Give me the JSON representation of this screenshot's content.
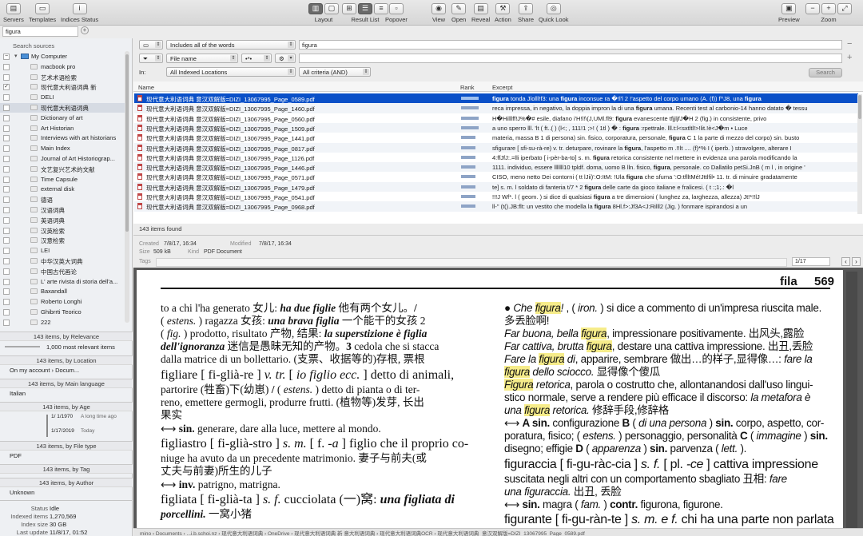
{
  "toolbar": {
    "servers": "Servers",
    "templates": "Templates",
    "indices_status": "Indices Status",
    "layout": "Layout",
    "result_list": "Result List",
    "popover": "Popover",
    "view": "View",
    "open": "Open",
    "reveal": "Reveal",
    "action": "Action",
    "share": "Share",
    "quick_look": "Quick Look",
    "preview": "Preview",
    "zoom": "Zoom"
  },
  "sidebar": {
    "search_value": "figura",
    "search_sources": "Search sources",
    "sources": [
      {
        "label": "My Computer",
        "checked": "minus"
      },
      {
        "label": "macbook pro"
      },
      {
        "label": "艺术术语检索"
      },
      {
        "label": "现代意大利语词典 新",
        "checked": "check"
      },
      {
        "label": "DELI"
      },
      {
        "label": "现代意大利语词典",
        "selected": true
      },
      {
        "label": "Dictionary of art"
      },
      {
        "label": "Art Historian"
      },
      {
        "label": "Interviews with art historians"
      },
      {
        "label": "Main Index"
      },
      {
        "label": "Journal of Art Historiograp..."
      },
      {
        "label": "文艺复兴艺术的文献"
      },
      {
        "label": "Time Capsule"
      },
      {
        "label": "external disk"
      },
      {
        "label": "德语"
      },
      {
        "label": "汉语词典"
      },
      {
        "label": "英语词典"
      },
      {
        "label": "汉英检索"
      },
      {
        "label": "汉意检索"
      },
      {
        "label": "LEI"
      },
      {
        "label": "中华汉英大词典"
      },
      {
        "label": "中国古代画论"
      },
      {
        "label": "L' arte rivista di storia dell'a..."
      },
      {
        "label": "Baxandall"
      },
      {
        "label": "Roberto Longhi"
      },
      {
        "label": "Ghibrrti Teorico"
      },
      {
        "label": "222"
      }
    ]
  },
  "facets": {
    "relevance_header": "143 items, by Relevance",
    "relevance_label": "1,000 most relevant items",
    "location_header": "143 items, by Location",
    "location_label": "On my account › Docum...",
    "location_count": "143",
    "language_header": "143 items, by Main language",
    "language_label": "Italian",
    "language_count": "143",
    "age_header": "143 items, by Age",
    "age_row1_date": "1/  1/1970",
    "age_row1_label": "A long time ago",
    "age_row2_date": "1/17/2019",
    "age_row2_label": "Today",
    "filetype_header": "143 items, by File type",
    "filetype_label": "PDF",
    "filetype_count": "143",
    "tag_header": "143 items, by Tag",
    "author_header": "143 items, by Author",
    "author_label": "Unknown",
    "author_count": "143"
  },
  "status": {
    "status_k": "Status",
    "status_v": "Idle",
    "indexed_k": "Indexed items",
    "indexed_v": "1,270,569",
    "size_k": "Index size",
    "size_v": "30 GB",
    "update_k": "Last update",
    "update_v": "11/8/17, 01:52"
  },
  "query": {
    "mode": "Includes all of the words",
    "term": "figura",
    "filter": "File name",
    "location": "All Indexed Locations",
    "criteria": "All criteria (AND)",
    "in_label": "In:",
    "search_button": "Search"
  },
  "results": {
    "col_name": "Name",
    "col_rank": "Rank",
    "col_excerpt": "Excerpt",
    "found": "143 items found",
    "rows": [
      {
        "name": "现代意大利语词典  意汉双解版=DIZI_13067995_Page_0589.pdf",
        "rank": 0.55,
        "ex_pre": "",
        "ex_hit": "figura",
        "ex_post": " tonda Jlolll!f3: una ",
        "ex_hit2": "figura",
        "ex_post2": " inconsue ra �!l'l 2 !'aspetto del corpo umano (A. (f)) f^J8, una ",
        "ex_hit3": "figura"
      },
      {
        "name": "现代意大利语词典  意汉双解版=DIZI_13067995_Page_1460.pdf",
        "rank": 0.55,
        "ex_pre": "reca impressa, in negativo, la doppia impron la di una ",
        "ex_hit": "figura",
        "ex_post": " umana. Recenti test al carbonio-14 hanno datato � tessu"
      },
      {
        "name": "现代意大利语词典  意汉双解版=DIZI_13067995_Page_0560.pdf",
        "rank": 0.55,
        "ex_pre": "H�Hilllff!J%�# esile, diafano i'H!l!\\(J,UMl.fl9: ",
        "ex_hit": "figura",
        "ex_post": " evanescente tfjjljfJ�H 2 (fig.) in consistente, privo"
      },
      {
        "name": "现代意大利语词典  意汉双解版=DIZI_13067995_Page_1509.pdf",
        "rank": 0.55,
        "ex_pre": "a uno sperro lll. 'lt ( ft..( ) (l<; , 111!1 ;>! ( 1tl ) � : ",
        "ex_hit": "figura",
        "ex_post": " :rpettrale. lll.t:l<sxtltl!>!lit.!è<J�m • Luce"
      },
      {
        "name": "现代意大利语词典  意汉双解版=DIZI_13067995_Page_1441.pdf",
        "rank": 0.44,
        "ex_pre": "materia, massa B 1 di persona) sin. fisico, corporatura, personale, ",
        "ex_hit": "figura",
        "ex_post": " C 1 la parte di mezzo del corpo) sin. busto"
      },
      {
        "name": "现代意大利语词典  意汉双解版=DIZI_13067995_Page_0817.pdf",
        "rank": 0.44,
        "ex_pre": "sfigurare [ sfi-su-rà-re) v. tr. deturpare, rovinare la ",
        "ex_hit": "figura",
        "ex_post": ", l'aspetto m .!!lt .... (f)*% I ( iperb. ) stravolgere, alterare I"
      },
      {
        "name": "现代意大利语词典  意汉双解版=DIZI_13067995_Page_1126.pdf",
        "rank": 0.44,
        "ex_pre": "4:ffJfJ:.=lli iperbato [ i-pèr-ba-to] s. m. ",
        "ex_hit": "figura",
        "ex_post": " retorica consistente nel mettere in evidenza una parola modificando la"
      },
      {
        "name": "现代意大利语词典  意汉双解版=DIZI_13067995_Page_1446.pdf",
        "rank": 0.44,
        "ex_pre": "1111. individuo, essere lllllll10 tpldf. doma, uomo B lln. fisico, ",
        "ex_hit": "figura",
        "ex_post": ", personale. co Dallatilo petSi.JnB ( m l , in origine '"
      },
      {
        "name": "现代意大利语词典  意汉双解版=DIZI_13067995_Page_0571.pdf",
        "rank": 0.44,
        "ex_pre": "CISO, meno netto Dei contorni ( tt lJii)':O:ItM: !Ula ",
        "ex_hit": "figura",
        "ex_post": " che sfuma ':O:tflltMé!Jttlfil• 11. tr. di minuire gradatamente"
      },
      {
        "name": "现代意大利语词典  意汉双解版=DIZI_13067995_Page_1479.pdf",
        "rank": 0.44,
        "ex_pre": "te] s. m. l soldato di fanteria t/7 * 2 ",
        "ex_hit": "figura",
        "ex_post": " delle carte da gioco italiane e fralicesi. ( t :;1;.: �l"
      },
      {
        "name": "现代意大利语词典  意汉双解版=DIZI_13067995_Page_0541.pdf",
        "rank": 0.44,
        "ex_pre": "!!!J Wf*. l ( geom. ) si dice di qualsiasi ",
        "ex_hit": "figura",
        "ex_post": " a tre dimensioni ( lunghez za, larghezza, allezza) Jt!*!!lJ"
      },
      {
        "name": "现代意大利语词典  意汉双解版=DIZI_13067995_Page_0968.pdf",
        "rank": 0.44,
        "ex_pre": "ll-\" (t().JB:flt: un vestito che modella la ",
        "ex_hit": "figura",
        "ex_post": " 8Hl.f>:Jf3A<J:Rilll2 (Jig. ) fonmare ispirandosi a un"
      }
    ]
  },
  "info": {
    "created_k": "Created",
    "created_v": "7/8/17, 16:34",
    "modified_k": "Modified",
    "modified_v": "7/8/17, 16:34",
    "size_k": "Size",
    "size_v": "509 kB",
    "kind_k": "Kind",
    "kind_v": "PDF Document",
    "tags_k": "Tags",
    "page_indicator": "1/17"
  },
  "document": {
    "running_head": "fila",
    "page_number": "569"
  },
  "path": {
    "text": "mino  ›  Documents  ›  ...i.b.schoi.nz  ›  现代意大利语词典  ›  OneDrive  ›  现代意大利语词典 新 意大利语词典  ›  现代意大利语词典OCR  ›  现代意大利语词典_意汉双解版=DIZI_13067995_Page_0589.pdf"
  }
}
